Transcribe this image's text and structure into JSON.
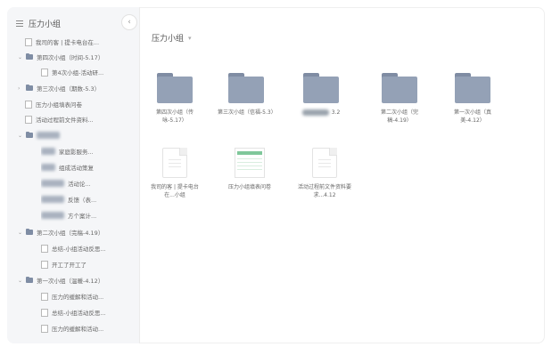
{
  "sidebar": {
    "title": "压力小组",
    "items": [
      {
        "label": "我司的客 | 提卡电台在...",
        "type": "doc"
      },
      {
        "label": "第四次小组（时间-5.17）",
        "type": "folder",
        "expanded": true
      },
      {
        "label": "第4次小组-活动研...",
        "type": "doc"
      },
      {
        "label": "第三次小组（期数-5.3）",
        "type": "folder",
        "expanded": false
      },
      {
        "label": "压力小组填表问卷",
        "type": "doc"
      },
      {
        "label": "活动过程前文件资料...",
        "type": "doc"
      },
      {
        "label": "",
        "type": "folder-blurred",
        "expanded": true
      },
      {
        "label": "家庭影服务...",
        "type": "blurred"
      },
      {
        "label": "组成活动策复",
        "type": "blurred"
      },
      {
        "label": "活动论...",
        "type": "blurred"
      },
      {
        "label": "反馈（表...",
        "type": "blurred"
      },
      {
        "label": "方个案计...",
        "type": "blurred"
      },
      {
        "label": "第二次小组（完稿-4.19）",
        "type": "folder",
        "expanded": true
      },
      {
        "label": "总结-小组活动反思...",
        "type": "doc"
      },
      {
        "label": "开工了开工了",
        "type": "doc"
      },
      {
        "label": "第一次小组（温暖-4.12）",
        "type": "folder",
        "expanded": true
      },
      {
        "label": "压力的缓解和活动...",
        "type": "doc"
      },
      {
        "label": "总结-小组活动反思...",
        "type": "doc"
      },
      {
        "label": "压力的缓解和活动...",
        "type": "doc"
      }
    ]
  },
  "main": {
    "breadcrumb": "压力小组",
    "folders": [
      {
        "name": "第四次小组（传咏-5.17）"
      },
      {
        "name": "第三次小组（信福-5.3）"
      },
      {
        "name": "3.2"
      },
      {
        "name": "第二次小组（完稿-4.19）"
      },
      {
        "name": "第一次小组（真美-4.12）"
      }
    ],
    "files": [
      {
        "name": "我司的客 | 提卡电台在...小组",
        "kind": "doc"
      },
      {
        "name": "压力小组填表问卷",
        "kind": "sheet"
      },
      {
        "name": "活动过程前文件资料要求...4.12",
        "kind": "doc"
      }
    ]
  },
  "colors": {
    "folder": "#94a1b6",
    "sidebar_bg": "#f5f6f8",
    "sheet_accent": "#7fc79a"
  }
}
